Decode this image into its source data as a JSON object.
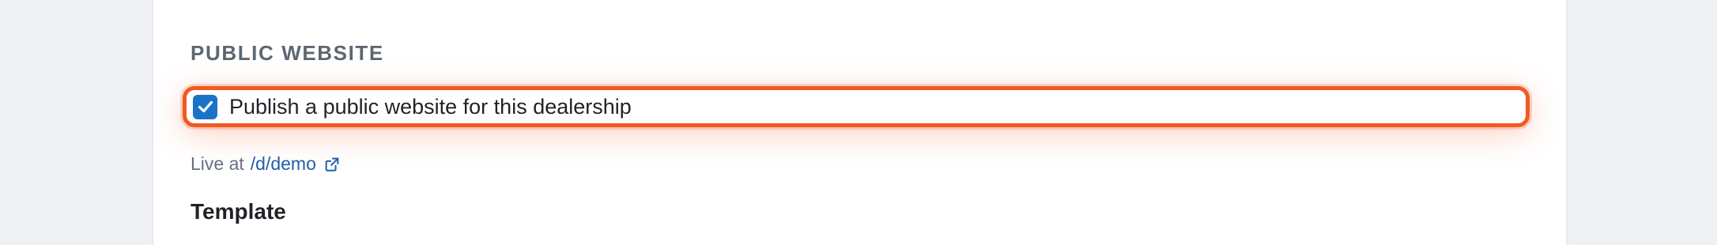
{
  "public_website": {
    "heading": "PUBLIC WEBSITE",
    "publish_checkbox": {
      "checked": true,
      "label": "Publish a public website for this dealership"
    },
    "live_prefix": "Live at",
    "live_link": "/d/demo",
    "external_link_icon": "external-link-icon"
  },
  "template": {
    "heading": "Template"
  },
  "colors": {
    "accent": "#1a73c8",
    "highlight": "#f05a22",
    "link": "#1f5fa8"
  }
}
